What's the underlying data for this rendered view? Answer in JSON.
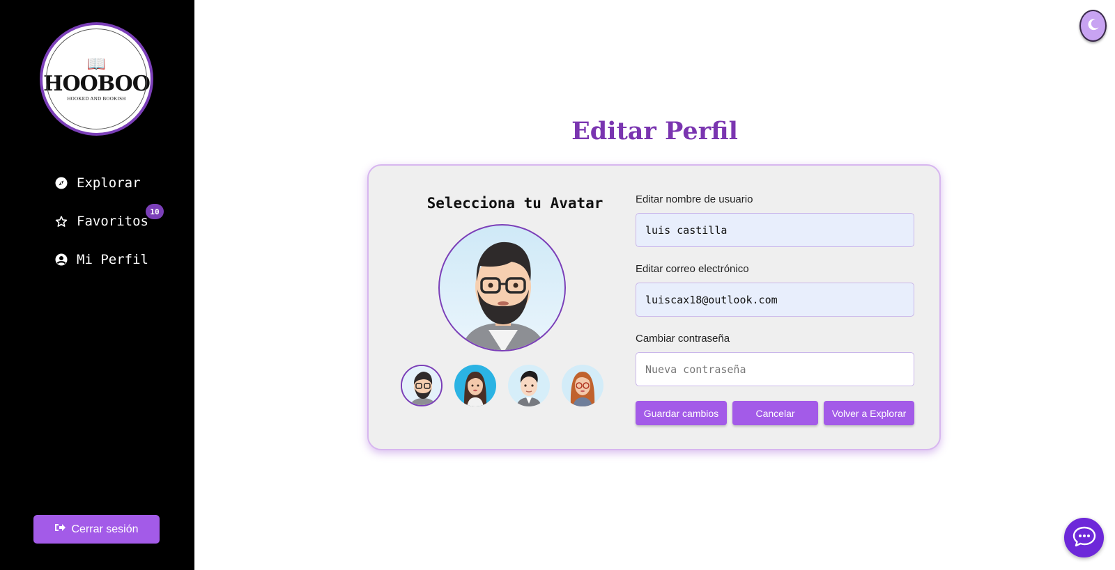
{
  "sidebar": {
    "logo": {
      "title": "HOOBOO",
      "subtitle": "HOOKED AND BOOKISH"
    },
    "items": [
      {
        "label": "Explorar",
        "icon": "compass-icon"
      },
      {
        "label": "Favoritos",
        "icon": "star-icon",
        "badge": "10"
      },
      {
        "label": "Mi Perfil",
        "icon": "user-circle-icon"
      }
    ],
    "logout_label": "Cerrar sesión"
  },
  "header": {
    "theme_icon": "moon-icon"
  },
  "main": {
    "title": "Editar Perfil",
    "avatar_section": {
      "title": "Selecciona tu Avatar",
      "options": [
        "avatar-man-beard-glasses",
        "avatar-woman-long-hair",
        "avatar-man-young",
        "avatar-woman-red-glasses"
      ],
      "selected_index": 0
    },
    "form": {
      "username_label": "Editar nombre de usuario",
      "username_value": "luis castilla",
      "email_label": "Editar correo electrónico",
      "email_value": "luiscax18@outlook.com",
      "password_label": "Cambiar contraseña",
      "password_placeholder": "Nueva contraseña",
      "save_label": "Guardar cambios",
      "cancel_label": "Cancelar",
      "back_label": "Volver a Explorar"
    }
  },
  "chat": {
    "icon": "chat-bubble-icon"
  },
  "colors": {
    "accent": "#a35be8",
    "brand": "#7a35b0",
    "sidebar_bg": "#000000"
  }
}
